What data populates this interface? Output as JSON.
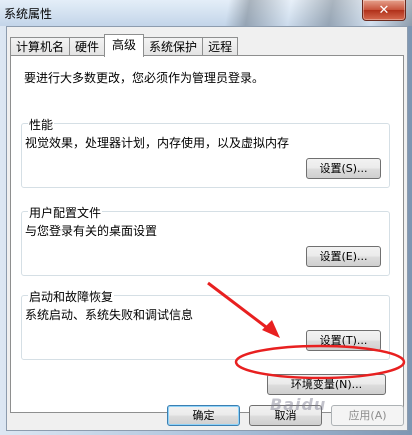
{
  "window": {
    "title": "系统属性",
    "close_glyph": "✕"
  },
  "tabs": [
    "计算机名",
    "硬件",
    "高级",
    "系统保护",
    "远程"
  ],
  "active_tab": "高级",
  "intro": "要进行大多数更改，您必须作为管理员登录。",
  "groups": {
    "performance": {
      "title": "性能",
      "desc": "视觉效果，处理器计划，内存使用，以及虚拟内存",
      "button": "设置(S)..."
    },
    "profiles": {
      "title": "用户配置文件",
      "desc": "与您登录有关的桌面设置",
      "button": "设置(E)..."
    },
    "startup": {
      "title": "启动和故障恢复",
      "desc": "系统启动、系统失败和调试信息",
      "button": "设置(T)..."
    }
  },
  "env_button": "环境变量(N)...",
  "footer": {
    "ok": "确定",
    "cancel": "取消",
    "apply": "应用(A)"
  },
  "watermark": "Baidu",
  "annotation_color": "#e82020"
}
